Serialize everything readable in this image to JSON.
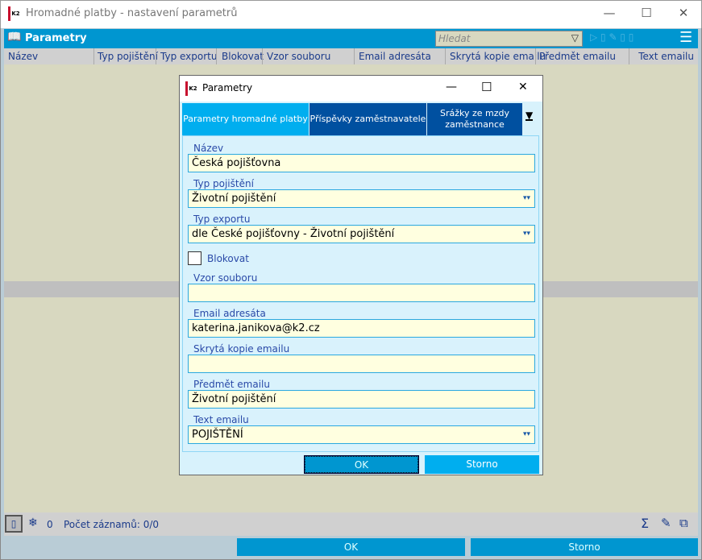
{
  "window": {
    "title": "Hromadné platby - nastavení parametrů",
    "logo": "K2",
    "minimize": "—",
    "maximize": "☐",
    "close": "✕"
  },
  "header": {
    "title": "Parametry",
    "search_placeholder": "Hledat"
  },
  "columns": [
    "Název",
    "Typ pojištění",
    "Typ exportu",
    "Blokovat",
    "Vzor souboru",
    "Email adresáta",
    "Skrytá kopie emailu",
    "Předmět emailu",
    "Text emailu"
  ],
  "status": {
    "frozen_count": "0",
    "records": "Počet záznamů: 0/0"
  },
  "bottom": {
    "ok": "OK",
    "cancel": "Storno"
  },
  "dialog": {
    "title": "Parametry",
    "tabs": [
      "Parametry hromadné platby",
      "Příspěvky zaměstnavatele",
      "Srážky ze mzdy zaměstnance"
    ],
    "fields": [
      {
        "label": "Název",
        "value": "Česká pojišťovna",
        "dropdown": false
      },
      {
        "label": "Typ pojištění",
        "value": "Životní pojištění",
        "dropdown": true
      },
      {
        "label": "Typ exportu",
        "value": "dle České pojišťovny - Životní pojištění",
        "dropdown": true
      }
    ],
    "checkbox": {
      "label": "Blokovat",
      "checked": false
    },
    "fields2": [
      {
        "label": "Vzor souboru",
        "value": "",
        "dropdown": false
      },
      {
        "label": "Email adresáta",
        "value": "katerina.janikova@k2.cz",
        "dropdown": false
      },
      {
        "label": "Skrytá kopie emailu",
        "value": "",
        "dropdown": false
      },
      {
        "label": "Předmět emailu",
        "value": "Životní pojištění",
        "dropdown": false
      },
      {
        "label": "Text emailu",
        "value": "POJIŠTĚNÍ",
        "dropdown": true
      }
    ],
    "ok": "OK",
    "cancel": "Storno"
  },
  "colors": {
    "accent": "#0096d0",
    "active_tab": "#00aeef",
    "tab": "#0050a0",
    "input_bg": "#ffffe0"
  }
}
